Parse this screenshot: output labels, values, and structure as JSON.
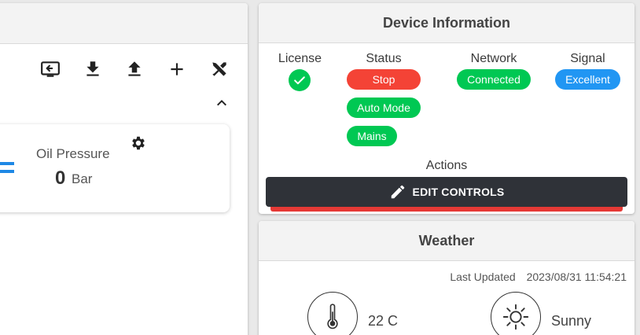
{
  "left_panel": {
    "toolbar": [
      {
        "name": "screen-share-icon"
      },
      {
        "name": "download-icon"
      },
      {
        "name": "upload-icon"
      },
      {
        "name": "add-icon"
      },
      {
        "name": "tools-icon"
      }
    ],
    "sensor": {
      "title": "Oil Pressure",
      "value": "0",
      "unit": "Bar",
      "icon": "pressure-compress-icon"
    }
  },
  "device": {
    "title": "Device Information",
    "license": {
      "label": "License",
      "icon": "check-circle-icon"
    },
    "status": {
      "label": "Status",
      "badges": [
        "Stop",
        "Auto Mode",
        "Mains"
      ]
    },
    "network": {
      "label": "Network",
      "value": "Connected"
    },
    "signal": {
      "label": "Signal",
      "value": "Excellent"
    },
    "actions": {
      "label": "Actions",
      "edit_button": "EDIT CONTROLS"
    },
    "colors": {
      "stop": "#f44336",
      "ok": "#00c853",
      "info": "#2196f3",
      "button": "#2f3238"
    }
  },
  "weather": {
    "title": "Weather",
    "last_updated_label": "Last Updated",
    "last_updated_value": "2023/08/31 11:54:21",
    "temperature": "22 C",
    "condition": "Sunny"
  }
}
